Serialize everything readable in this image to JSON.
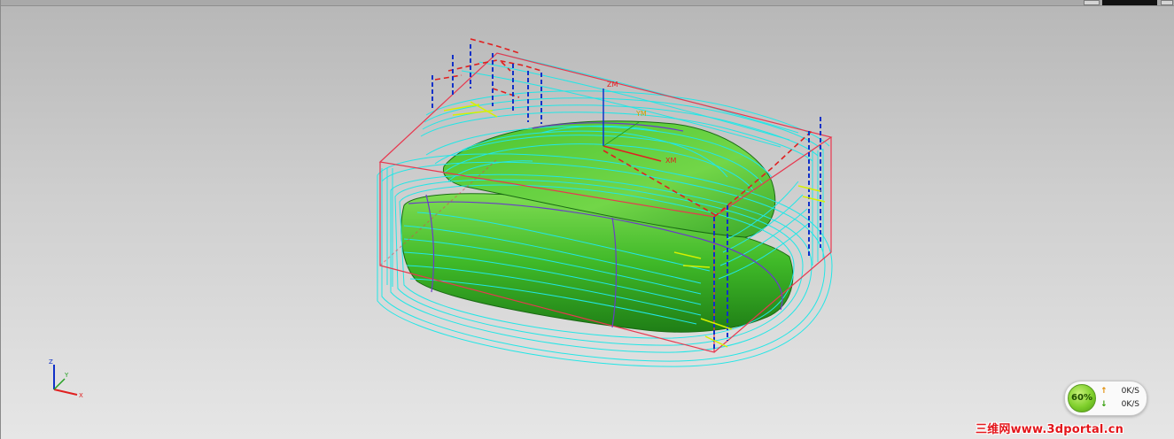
{
  "axes": {
    "triad": {
      "z": "Z",
      "y": "Y",
      "x": "X"
    },
    "model": {
      "zm": "ZM",
      "ym": "YM",
      "xm": "XM"
    }
  },
  "colors": {
    "toolpath": "#22e6e6",
    "part": "#3fb928",
    "part_highlight": "#7fdc52",
    "blank_box": "#e8384f",
    "feed_moves": "#1030c8",
    "rapid_moves": "#e02020",
    "engage": "#d6f000",
    "boundary": "#6a3cc8"
  },
  "network_monitor": {
    "percent": "60%",
    "upload_icon": "arrow-up-icon",
    "download_icon": "arrow-down-icon",
    "upload_speed": "0K/S",
    "download_speed": "0K/S"
  },
  "watermark": {
    "text": "三维网www.3dportal.cn"
  }
}
